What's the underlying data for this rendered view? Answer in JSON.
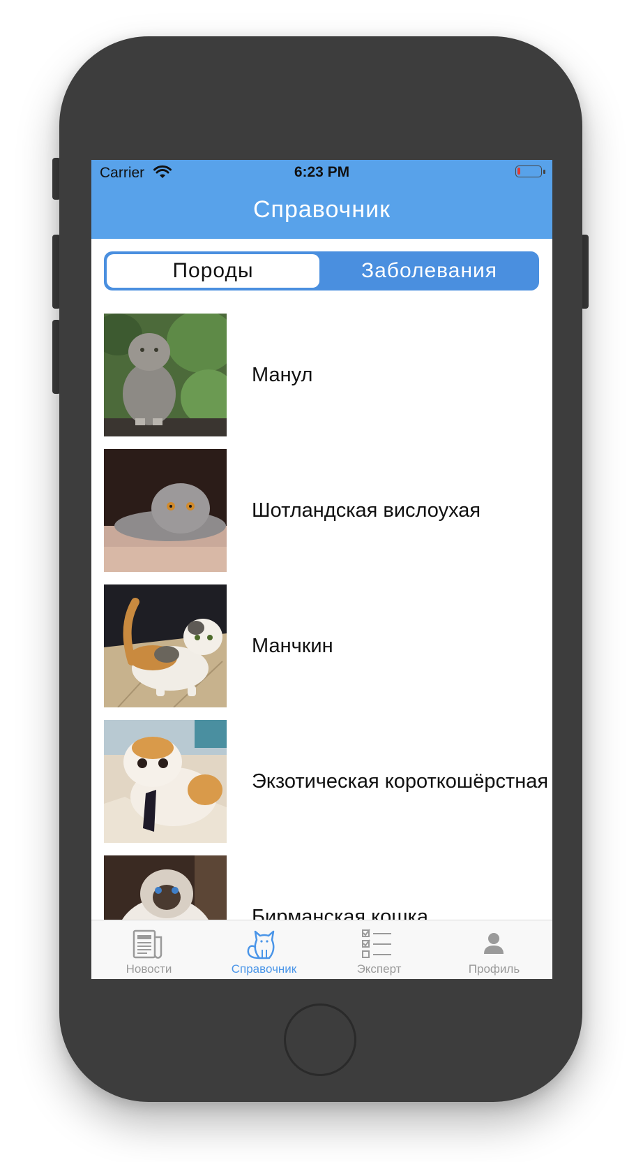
{
  "status_bar": {
    "carrier": "Carrier",
    "time": "6:23 PM",
    "wifi_icon": "wifi-icon",
    "battery_icon": "battery-low-icon"
  },
  "nav": {
    "title": "Справочник"
  },
  "segmented": {
    "left_label": "Породы",
    "right_label": "Заболевания",
    "selected": "Породы"
  },
  "breeds": [
    {
      "name": "Манул",
      "image": "pallas-cat-photo"
    },
    {
      "name": "Шотландская вислоухая",
      "image": "scottish-fold-photo"
    },
    {
      "name": "Манчкин",
      "image": "munchkin-photo"
    },
    {
      "name": "Экзотическая короткошёрстная",
      "image": "exotic-shorthair-photo"
    },
    {
      "name": "Бирманская кошка",
      "image": "birman-photo"
    }
  ],
  "tabbar": {
    "items": [
      {
        "label": "Новости",
        "icon": "newspaper-icon"
      },
      {
        "label": "Справочник",
        "icon": "cat-icon",
        "active": true
      },
      {
        "label": "Эксперт",
        "icon": "checklist-icon"
      },
      {
        "label": "Профиль",
        "icon": "user-icon"
      }
    ]
  },
  "colors": {
    "accent": "#58a2ea",
    "segment": "#4a8fdf",
    "active_tab": "#4a95e8",
    "inactive_tab": "#9a9a9a",
    "phone_body": "#3d3d3d"
  }
}
